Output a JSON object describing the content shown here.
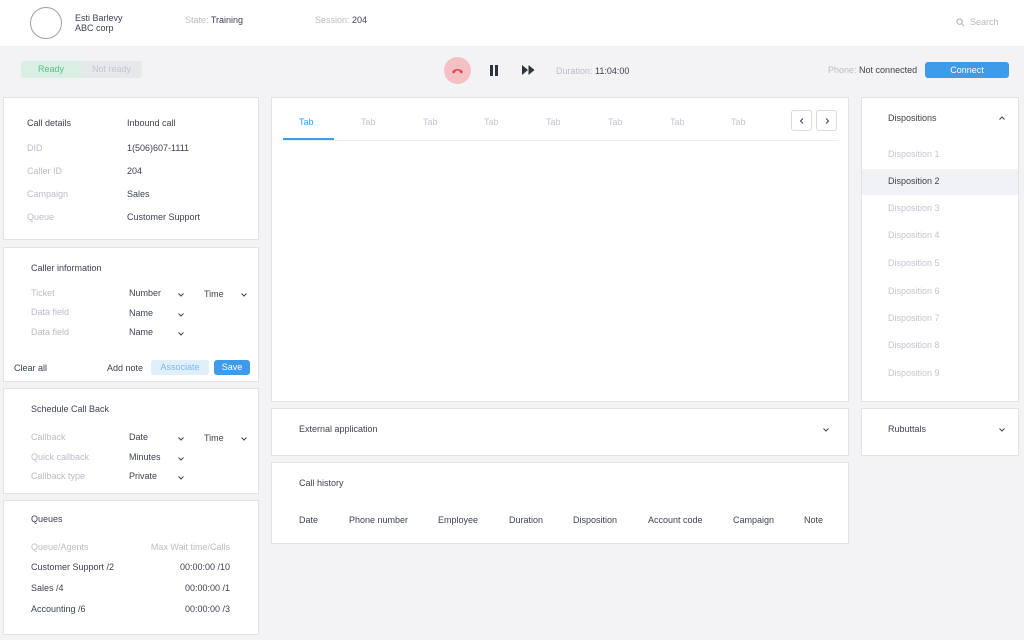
{
  "header": {
    "user_name": "Esti Barlevy",
    "user_company": "ABC corp",
    "state_label": "State:",
    "state_value": "Training",
    "session_label": "Session:",
    "session_value": "204",
    "search_label": "Search"
  },
  "toolbar": {
    "ready_label": "Ready",
    "not_ready_label": "Not ready",
    "duration_label": "Duration:",
    "duration_value": "11:04:00",
    "phone_label": "Phone:",
    "phone_value": "Not connected",
    "connect_label": "Connect"
  },
  "call_details": {
    "title": "Call details",
    "type": "Inbound call",
    "rows": [
      {
        "label": "DID",
        "value": "1(506)607-1111"
      },
      {
        "label": "Caller ID",
        "value": "204"
      },
      {
        "label": "Campaign",
        "value": "Sales"
      },
      {
        "label": "Queue",
        "value": "Customer Support"
      }
    ]
  },
  "caller_info": {
    "title": "Caller information",
    "rows": [
      {
        "label": "Ticket",
        "select1": "Number",
        "select2": "Time"
      },
      {
        "label": "Data field",
        "select1": "Name"
      },
      {
        "label": "Data field",
        "select1": "Name"
      }
    ],
    "clear_all": "Clear all",
    "add_note": "Add note",
    "associate": "Associate",
    "save": "Save"
  },
  "schedule": {
    "title": "Schedule Call Back",
    "rows": [
      {
        "label": "Callback",
        "select1": "Date",
        "select2": "Time"
      },
      {
        "label": "Quick callback",
        "select1": "Minutes"
      },
      {
        "label": "Callback type",
        "select1": "Private"
      }
    ]
  },
  "queues": {
    "title": "Queues",
    "col1": "Queue/Agents",
    "col2": "Max Wait time/Calls",
    "rows": [
      {
        "name": "Customer Support /2",
        "value": "00:00:00 /10"
      },
      {
        "name": "Sales /4",
        "value": "00:00:00 /1"
      },
      {
        "name": "Accounting /6",
        "value": "00:00:00 /3"
      }
    ]
  },
  "tabs": [
    "Tab",
    "Tab",
    "Tab",
    "Tab",
    "Tab",
    "Tab",
    "Tab",
    "Tab"
  ],
  "external_app": {
    "title": "External application"
  },
  "call_history": {
    "title": "Call history",
    "columns": [
      "Date",
      "Phone number",
      "Employee",
      "Duration",
      "Disposition",
      "Account code",
      "Campaign",
      "Note"
    ]
  },
  "dispositions": {
    "title": "Dispositions",
    "items": [
      "Disposition 1",
      "Disposition 2",
      "Disposition 3",
      "Disposition 4",
      "Disposition 5",
      "Disposition 6",
      "Disposition 7",
      "Disposition 8",
      "Disposition 9"
    ],
    "selected_index": 1
  },
  "rebuttals": {
    "title": "Rubuttals"
  },
  "colors": {
    "accent": "#3d9be9",
    "ready_bg": "#d9efe4",
    "ready_text": "#5fb98c",
    "hangup_bg": "#f4c0c4",
    "hangup_icon": "#e0444e"
  }
}
